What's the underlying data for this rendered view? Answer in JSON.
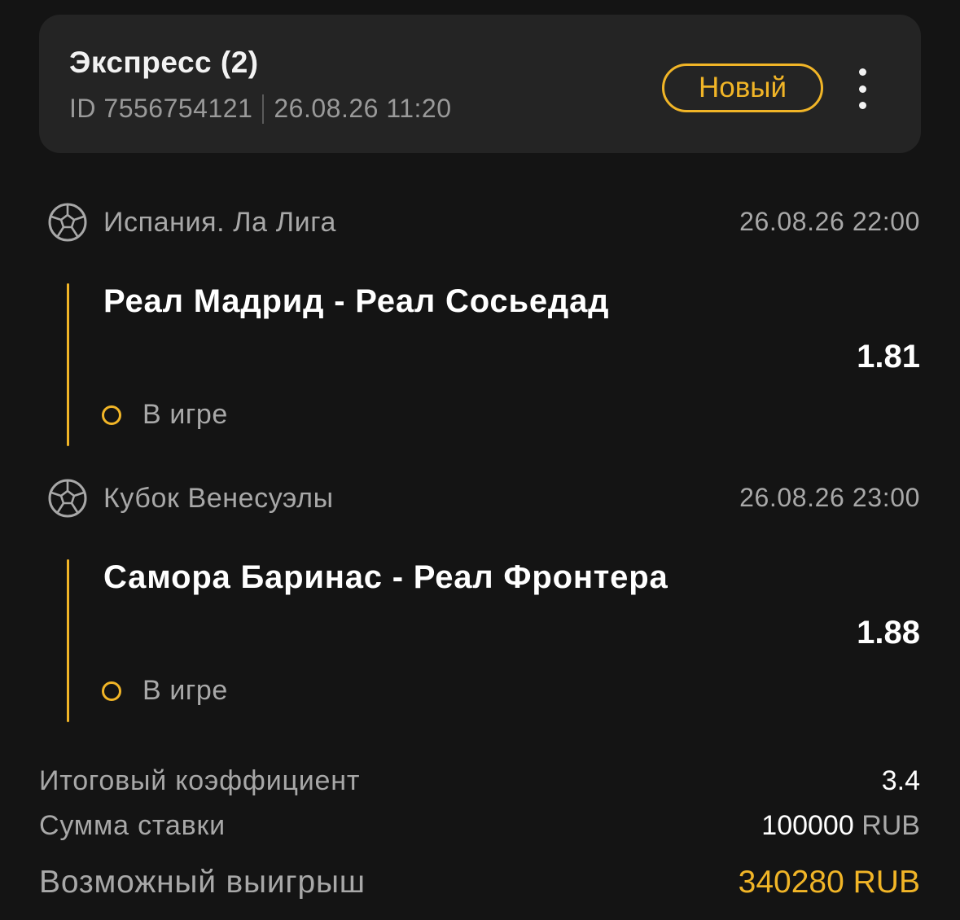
{
  "header": {
    "title": "Экспресс (2)",
    "id_label": "ID 7556754121",
    "datetime": "26.08.26 11:20",
    "status_badge": "Новый"
  },
  "events": [
    {
      "league": "Испания. Ла Лига",
      "start_time": "26.08.26 22:00",
      "match": "Реал Мадрид - Реал Сосьедад",
      "odds": "1.81",
      "status": "В игре"
    },
    {
      "league": "Кубок Венесуэлы",
      "start_time": "26.08.26 23:00",
      "match": "Самора Баринас - Реал Фронтера",
      "odds": "1.88",
      "status": "В игре"
    }
  ],
  "summary": {
    "total_odds_label": "Итоговый коэффициент",
    "total_odds_value": "3.4",
    "stake_label": "Сумма ставки",
    "stake_amount": "100000",
    "stake_currency": "RUB",
    "possible_win_label": "Возможный выигрыш",
    "possible_win_value": "340280 RUB"
  },
  "icons": {
    "sport": "soccer-ball-icon",
    "more": "more-vertical-icon",
    "status": "status-ring-icon"
  },
  "colors": {
    "accent": "#f1b527",
    "background": "#141414",
    "card": "#242424",
    "muted_text": "#a8a8a8"
  }
}
